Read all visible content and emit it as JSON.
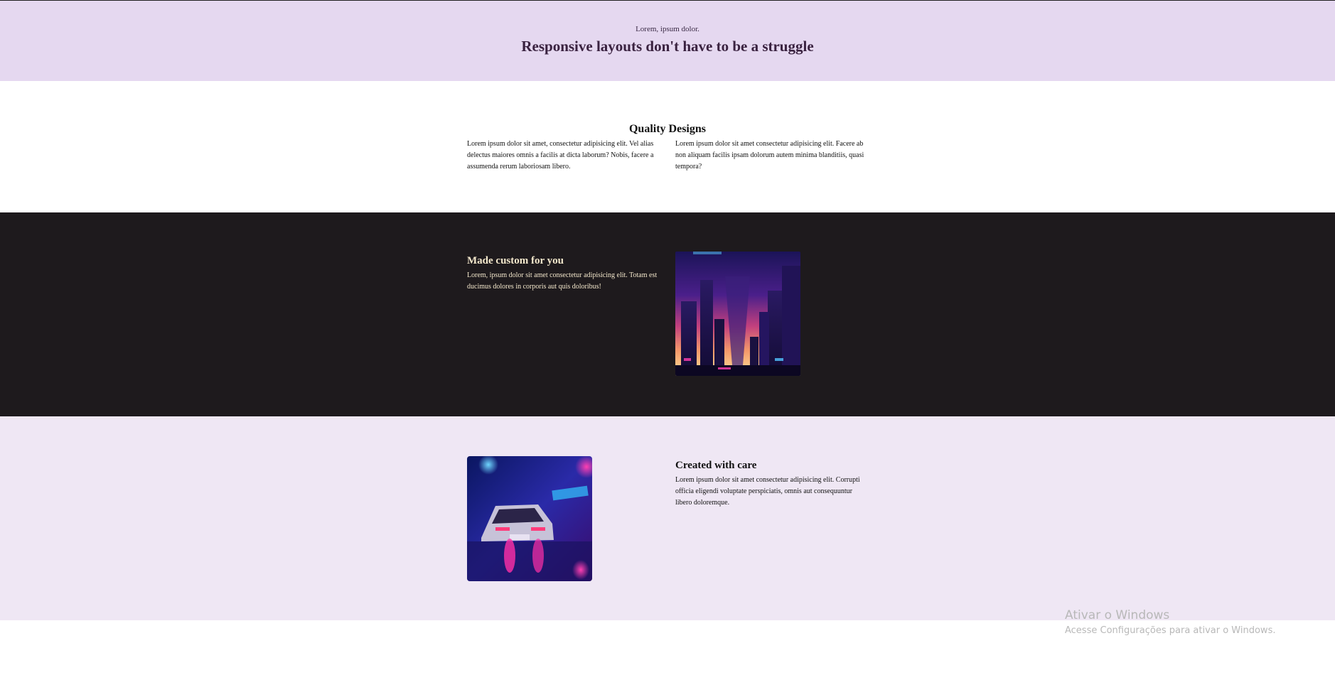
{
  "hero": {
    "kicker": "Lorem, ipsum dolor.",
    "title": "Responsive layouts don't have to be a struggle"
  },
  "quality": {
    "title": "Quality Designs",
    "left_text": "Lorem ipsum dolor sit amet, consectetur adipisicing elit. Vel alias delectus maiores omnis a facilis at dicta laborum? Nobis, facere a assumenda rerum laboriosam libero.",
    "right_text": "Lorem ipsum dolor sit amet consectetur adipisicing elit. Facere ab non aliquam facilis ipsam dolorum autem minima blanditiis, quasi tempora?"
  },
  "custom": {
    "title": "Made custom for you",
    "text": "Lorem, ipsum dolor sit amet consectetur adipisicing elit. Totam est ducimus dolores in corporis aut quis doloribus!",
    "image": "neon-city-skyline"
  },
  "care": {
    "title": "Created with care",
    "text": "Lorem ipsum dolor sit amet consectetur adipisicing elit. Corrupti officia eligendi voluptate perspiciatis, omnis aut consequuntur libero doloremque.",
    "image": "neon-car-night"
  },
  "watermark": {
    "line1": "Ativar o Windows",
    "line2": "Acesse Configurações para ativar o Windows."
  },
  "colors": {
    "hero_bg": "#e5d8f0",
    "dark_bg": "#1e1a1d",
    "care_bg": "#efe7f4",
    "cream_text": "#f4e8cc"
  }
}
